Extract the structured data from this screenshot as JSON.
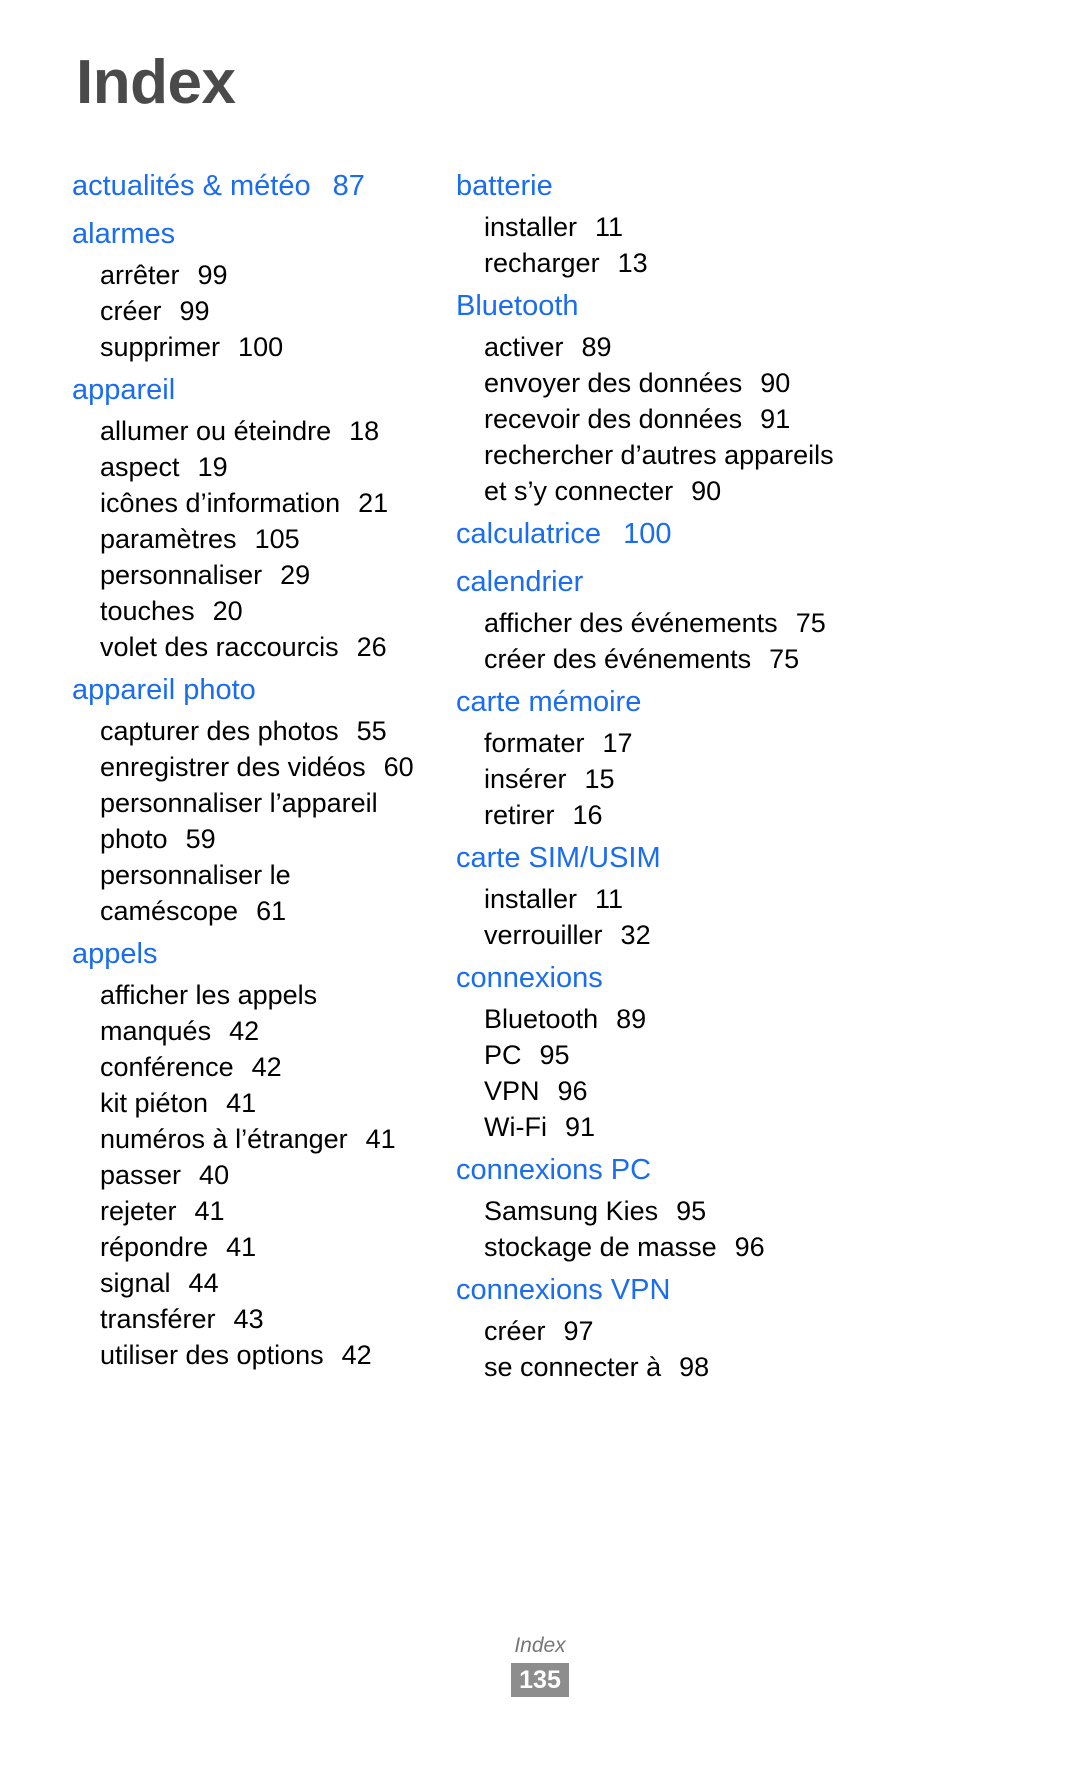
{
  "document": {
    "title": "Index",
    "accent_color": "#1a6cf0",
    "title_color": "#4a4a4a",
    "footer": {
      "label": "Index",
      "page_number": "135",
      "badge_color": "#8d8d8d"
    }
  },
  "columns": [
    {
      "id": "left",
      "groups": [
        {
          "heading": "actualités & météo",
          "page": "87",
          "items": []
        },
        {
          "heading": "alarmes",
          "page": "",
          "items": [
            {
              "label": "arrêter",
              "page": "99"
            },
            {
              "label": "créer",
              "page": "99"
            },
            {
              "label": "supprimer",
              "page": "100"
            }
          ]
        },
        {
          "heading": "appareil",
          "page": "",
          "items": [
            {
              "label": "allumer ou éteindre",
              "page": "18"
            },
            {
              "label": "aspect",
              "page": "19"
            },
            {
              "label": "icônes d’information",
              "page": "21"
            },
            {
              "label": "paramètres",
              "page": "105"
            },
            {
              "label": "personnaliser",
              "page": "29"
            },
            {
              "label": "touches",
              "page": "20"
            },
            {
              "label": "volet des raccourcis",
              "page": "26"
            }
          ]
        },
        {
          "heading": "appareil photo",
          "page": "",
          "items": [
            {
              "label": "capturer des photos",
              "page": "55"
            },
            {
              "label": "enregistrer des vidéos",
              "page": "60"
            },
            {
              "label": "personnaliser l’appareil",
              "page": ""
            },
            {
              "label": "photo",
              "page": "59"
            },
            {
              "label": "personnaliser le",
              "page": ""
            },
            {
              "label": "caméscope",
              "page": "61"
            }
          ]
        },
        {
          "heading": "appels",
          "page": "",
          "items": [
            {
              "label": "afficher les appels",
              "page": ""
            },
            {
              "label": "manqués",
              "page": "42"
            },
            {
              "label": "conférence",
              "page": "42"
            },
            {
              "label": "kit piéton",
              "page": "41"
            },
            {
              "label": "numéros à l’étranger",
              "page": "41"
            },
            {
              "label": "passer",
              "page": "40"
            },
            {
              "label": "rejeter",
              "page": "41"
            },
            {
              "label": "répondre",
              "page": "41"
            },
            {
              "label": "signal",
              "page": "44"
            },
            {
              "label": "transférer",
              "page": "43"
            },
            {
              "label": "utiliser des options",
              "page": "42"
            }
          ]
        }
      ]
    },
    {
      "id": "right",
      "groups": [
        {
          "heading": "batterie",
          "page": "",
          "items": [
            {
              "label": "installer",
              "page": "11"
            },
            {
              "label": "recharger",
              "page": "13"
            }
          ]
        },
        {
          "heading": "Bluetooth",
          "page": "",
          "items": [
            {
              "label": "activer",
              "page": "89"
            },
            {
              "label": "envoyer des données",
              "page": "90"
            },
            {
              "label": "recevoir des données",
              "page": "91"
            },
            {
              "label": "rechercher d’autres appareils",
              "page": ""
            },
            {
              "label": "et s’y connecter",
              "page": "90"
            }
          ]
        },
        {
          "heading": "calculatrice",
          "page": "100",
          "items": []
        },
        {
          "heading": "calendrier",
          "page": "",
          "items": [
            {
              "label": "afficher des événements",
              "page": "75"
            },
            {
              "label": "créer des événements",
              "page": "75"
            }
          ]
        },
        {
          "heading": "carte mémoire",
          "page": "",
          "items": [
            {
              "label": "formater",
              "page": "17"
            },
            {
              "label": "insérer",
              "page": "15"
            },
            {
              "label": "retirer",
              "page": "16"
            }
          ]
        },
        {
          "heading": "carte SIM/USIM",
          "page": "",
          "items": [
            {
              "label": "installer",
              "page": "11"
            },
            {
              "label": "verrouiller",
              "page": "32"
            }
          ]
        },
        {
          "heading": "connexions",
          "page": "",
          "items": [
            {
              "label": "Bluetooth",
              "page": "89"
            },
            {
              "label": "PC",
              "page": "95"
            },
            {
              "label": "VPN",
              "page": "96"
            },
            {
              "label": "Wi-Fi",
              "page": "91"
            }
          ]
        },
        {
          "heading": "connexions PC",
          "page": "",
          "items": [
            {
              "label": "Samsung Kies",
              "page": "95"
            },
            {
              "label": "stockage de masse",
              "page": "96"
            }
          ]
        },
        {
          "heading": "connexions VPN",
          "page": "",
          "items": [
            {
              "label": "créer",
              "page": "97"
            },
            {
              "label": "se connecter à",
              "page": "98"
            }
          ]
        }
      ]
    }
  ]
}
